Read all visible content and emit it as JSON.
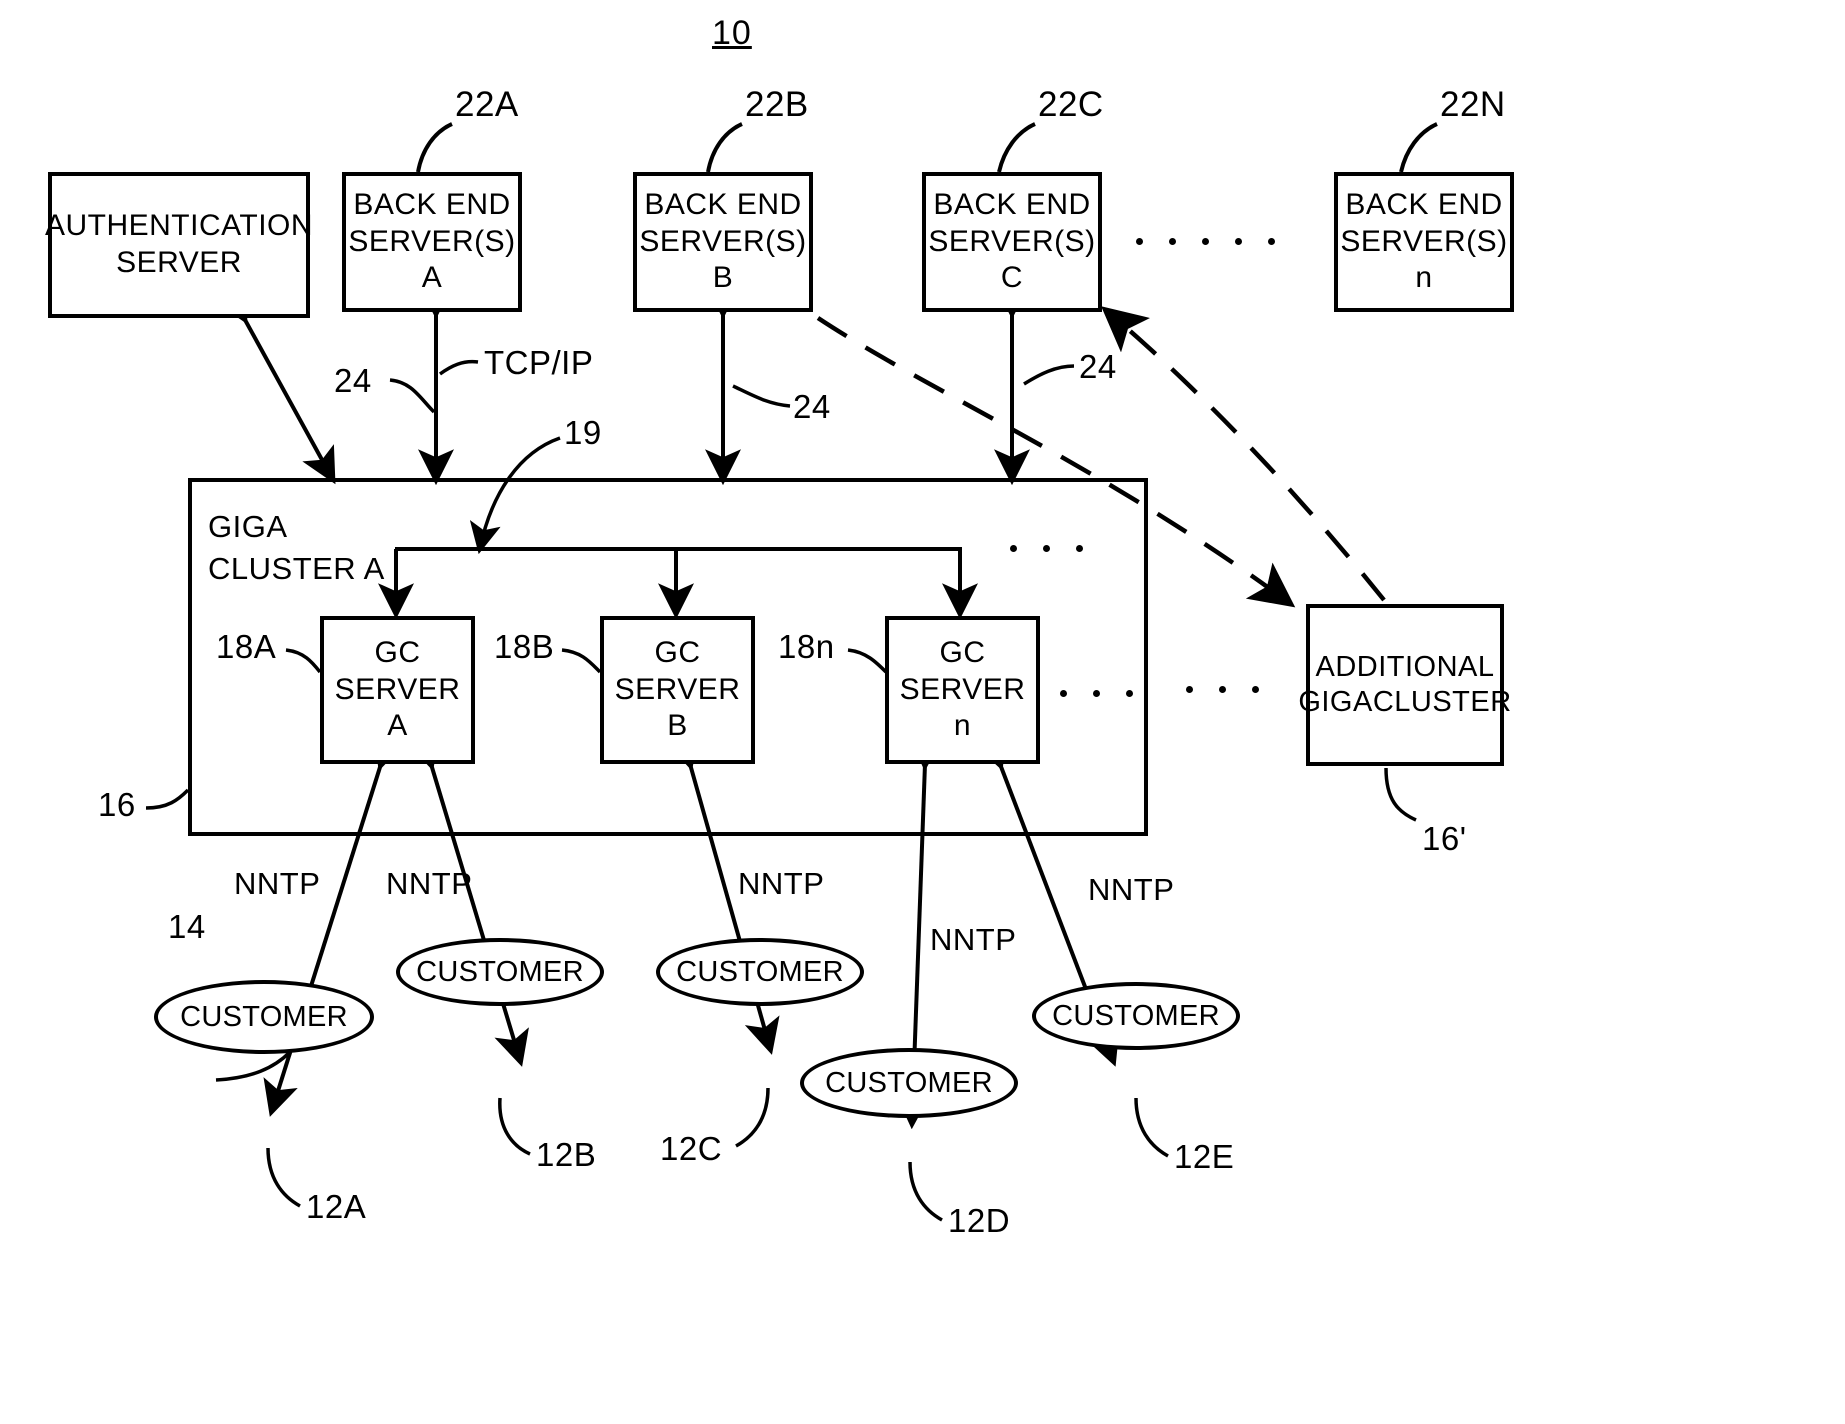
{
  "figure": {
    "number": "10"
  },
  "top_boxes": [
    {
      "name": "authentication-server",
      "lines": [
        "AUTHENTICATION",
        "SERVER"
      ],
      "ref": ""
    },
    {
      "name": "back-end-server-a",
      "lines": [
        "BACK END",
        "SERVER(S)",
        "A"
      ],
      "ref": "22A"
    },
    {
      "name": "back-end-server-b",
      "lines": [
        "BACK END",
        "SERVER(S)",
        "B"
      ],
      "ref": "22B"
    },
    {
      "name": "back-end-server-c",
      "lines": [
        "BACK END",
        "SERVER(S)",
        "C"
      ],
      "ref": "22C"
    },
    {
      "name": "back-end-server-n",
      "lines": [
        "BACK END",
        "SERVER(S)",
        "n"
      ],
      "ref": "22N"
    }
  ],
  "cluster": {
    "label_lines": [
      "GIGA",
      "CLUSTER A"
    ],
    "ref": "16",
    "switch_ref": "19",
    "gc_servers": [
      {
        "name": "gc-server-a",
        "lines": [
          "GC",
          "SERVER",
          "A"
        ],
        "ref": "18A"
      },
      {
        "name": "gc-server-b",
        "lines": [
          "GC",
          "SERVER",
          "B"
        ],
        "ref": "18B"
      },
      {
        "name": "gc-server-n",
        "lines": [
          "GC",
          "SERVER",
          "n"
        ],
        "ref": "18n"
      }
    ]
  },
  "additional_cluster": {
    "lines": [
      "ADDITIONAL",
      "GIGACLUSTER"
    ],
    "ref": "16'"
  },
  "link_labels": {
    "tcpip": "TCP/IP",
    "backend_links": [
      "24",
      "24",
      "24"
    ],
    "customer_link_ref": "14",
    "nntp": "NNTP"
  },
  "customers": [
    {
      "name": "customer-a",
      "label": "CUSTOMER",
      "ref": "12A"
    },
    {
      "name": "customer-b",
      "label": "CUSTOMER",
      "ref": "12B"
    },
    {
      "name": "customer-c",
      "label": "CUSTOMER",
      "ref": "12C"
    },
    {
      "name": "customer-d",
      "label": "CUSTOMER",
      "ref": "12D"
    },
    {
      "name": "customer-e",
      "label": "CUSTOMER",
      "ref": "12E"
    }
  ],
  "nntp_labels": [
    "NNTP",
    "NNTP",
    "NNTP",
    "NNTP",
    "NNTP"
  ],
  "colors": {
    "ink": "#000000",
    "paper": "#ffffff"
  }
}
